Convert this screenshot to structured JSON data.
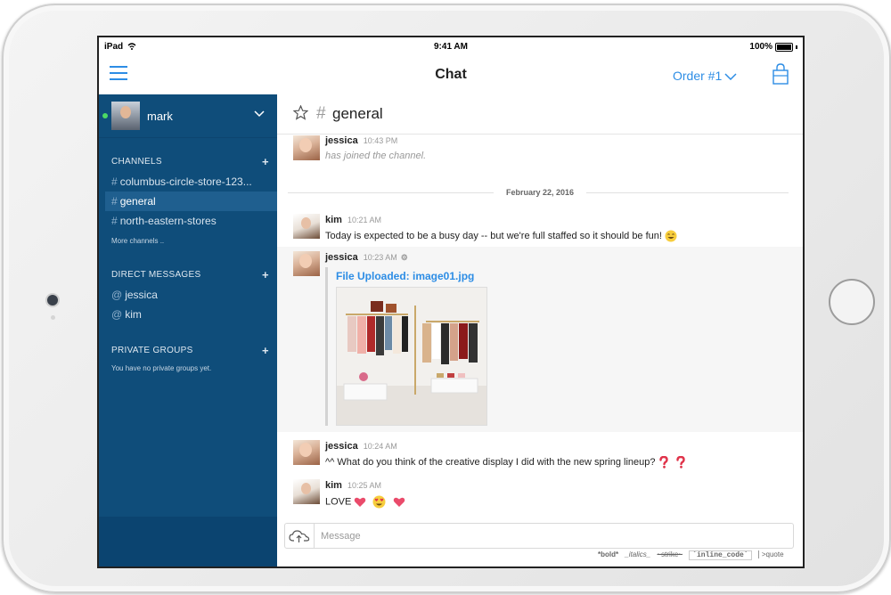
{
  "status_bar": {
    "device": "iPad",
    "time": "9:41 AM",
    "battery": "100%"
  },
  "navbar": {
    "title": "Chat",
    "order_label": "Order #1"
  },
  "sidebar": {
    "username": "mark",
    "channels_header": "CHANNELS",
    "channels": [
      {
        "prefix": "#",
        "label": "columbus-circle-store-123..."
      },
      {
        "prefix": "#",
        "label": "general"
      },
      {
        "prefix": "#",
        "label": "north-eastern-stores"
      }
    ],
    "more_channels": "More channels ..",
    "dm_header": "DIRECT MESSAGES",
    "dms": [
      {
        "prefix": "@",
        "label": "jessica"
      },
      {
        "prefix": "@",
        "label": "kim"
      }
    ],
    "private_header": "PRIVATE GROUPS",
    "private_empty": "You have no private groups yet.",
    "add_symbol": "+"
  },
  "channel": {
    "hash": "#",
    "name": "general"
  },
  "messages": [
    {
      "author": "jessica",
      "time": "10:43 PM",
      "text": "has joined the channel."
    },
    {
      "author": "kim",
      "time": "10:21 AM",
      "text": "Today is expected to be a busy day -- but we're full staffed so it should be fun!"
    },
    {
      "author": "jessica",
      "time": "10:23 AM",
      "file_label": "File Uploaded: image01.jpg"
    },
    {
      "author": "jessica",
      "time": "10:24 AM",
      "text": "^^ What do you think of the creative display I did with the new spring lineup?"
    },
    {
      "author": "kim",
      "time": "10:25 AM",
      "text": "LOVE"
    }
  ],
  "date_divider": "February 22, 2016",
  "composer": {
    "placeholder": "Message"
  },
  "format_hints": {
    "bold": "*bold*",
    "italics": "_italics_",
    "strike": "~strike~",
    "code": "`inline_code`",
    "quote": ">quote"
  },
  "colors": {
    "accent": "#2d8de5",
    "sidebar": "#0f4d7a",
    "online": "#4cd964"
  },
  "icons": [
    "hamburger-icon",
    "chevron-down-icon",
    "shopping-bag-icon",
    "star-icon",
    "gear-icon",
    "cloud-upload-icon",
    "smile-emoji",
    "question-emoji",
    "heart-emoji",
    "heart-eyes-emoji"
  ]
}
